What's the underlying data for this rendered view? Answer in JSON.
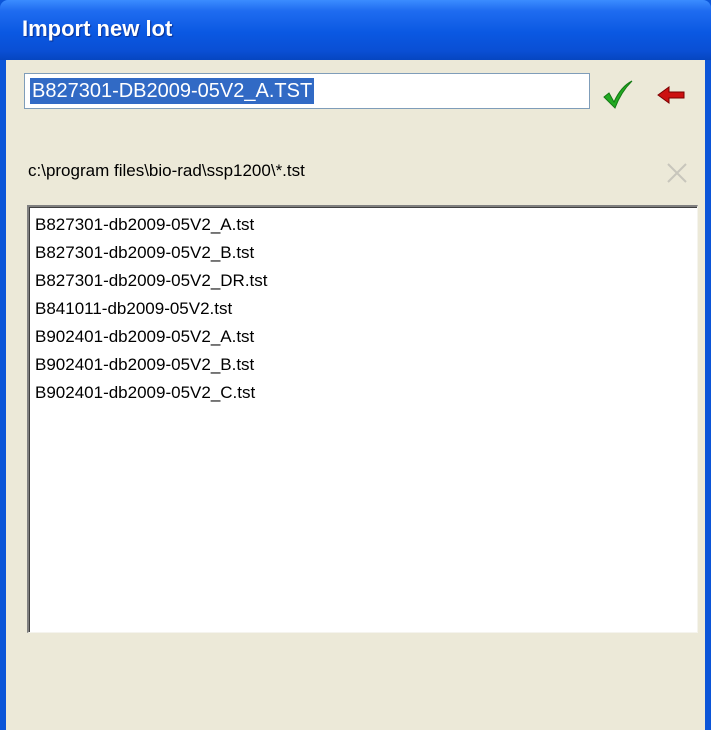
{
  "window": {
    "title": "Import new lot"
  },
  "lot_field": {
    "value": "B827301-DB2009-05V2_A.TST"
  },
  "icons": {
    "ok": "checkmark-icon",
    "back": "back-arrow-icon",
    "clear": "close-x-icon",
    "colors": {
      "ok": "#22aa22",
      "back": "#cc1111",
      "clear_disabled": "#c8c6bc",
      "selection": "#316ac5",
      "titlebar": "#0a58e2",
      "panel": "#ece9d8"
    }
  },
  "path_label": "c:\\program files\\bio-rad\\ssp1200\\*.tst",
  "files": [
    "B827301-db2009-05V2_A.tst",
    "B827301-db2009-05V2_B.tst",
    "B827301-db2009-05V2_DR.tst",
    "B841011-db2009-05V2.tst",
    "B902401-db2009-05V2_A.tst",
    "B902401-db2009-05V2_B.tst",
    "B902401-db2009-05V2_C.tst"
  ]
}
